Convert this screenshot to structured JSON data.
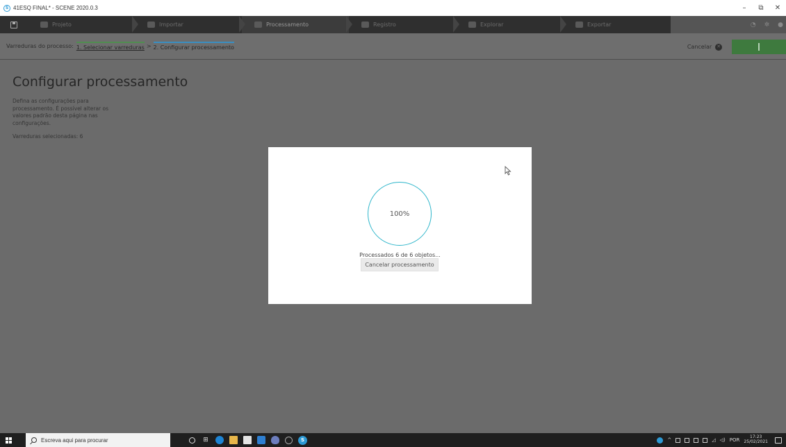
{
  "window": {
    "title": "41ESQ FINAL* - SCENE 2020.0.3",
    "app_icon_letter": "S",
    "controls": {
      "minimize": "–",
      "maximize": "⧉",
      "close": "✕"
    }
  },
  "workflow_nav": {
    "steps": [
      {
        "label": "Projeto",
        "icon": "folder-icon"
      },
      {
        "label": "Importar",
        "icon": "import-icon"
      },
      {
        "label": "Processamento",
        "icon": "processing-icon",
        "active": true
      },
      {
        "label": "Registro",
        "icon": "registration-icon"
      },
      {
        "label": "Explorar",
        "icon": "explore-icon"
      },
      {
        "label": "Exportar",
        "icon": "export-icon"
      }
    ],
    "right_icons": [
      "help-icon",
      "settings-icon",
      "info-icon"
    ]
  },
  "breadcrumb": {
    "label": "Varreduras do processo:",
    "step1": "1. Selecionar varreduras",
    "separator": ">",
    "step2": "2. Configurar processamento",
    "cancel_label": "Cancelar"
  },
  "page": {
    "title": "Configurar processamento",
    "description": "Defina as configurações para processamento. É possível alterar os valores padrão desta página nas configurações.",
    "selected_scans": "Varreduras selecionadas: 6"
  },
  "modal": {
    "progress_text": "100%",
    "progress_value": 100,
    "status": "Processados 6 de 6 objetos...",
    "cancel_button": "Cancelar processamento"
  },
  "taskbar": {
    "search_placeholder": "Escreva aqui para procurar",
    "language": "POR",
    "time": "17:23",
    "date": "25/02/2021"
  },
  "colors": {
    "accent_green": "#3e7a3e",
    "progress_ring": "#2cb5ca",
    "breadcrumb_active": "#3a8fc2"
  }
}
